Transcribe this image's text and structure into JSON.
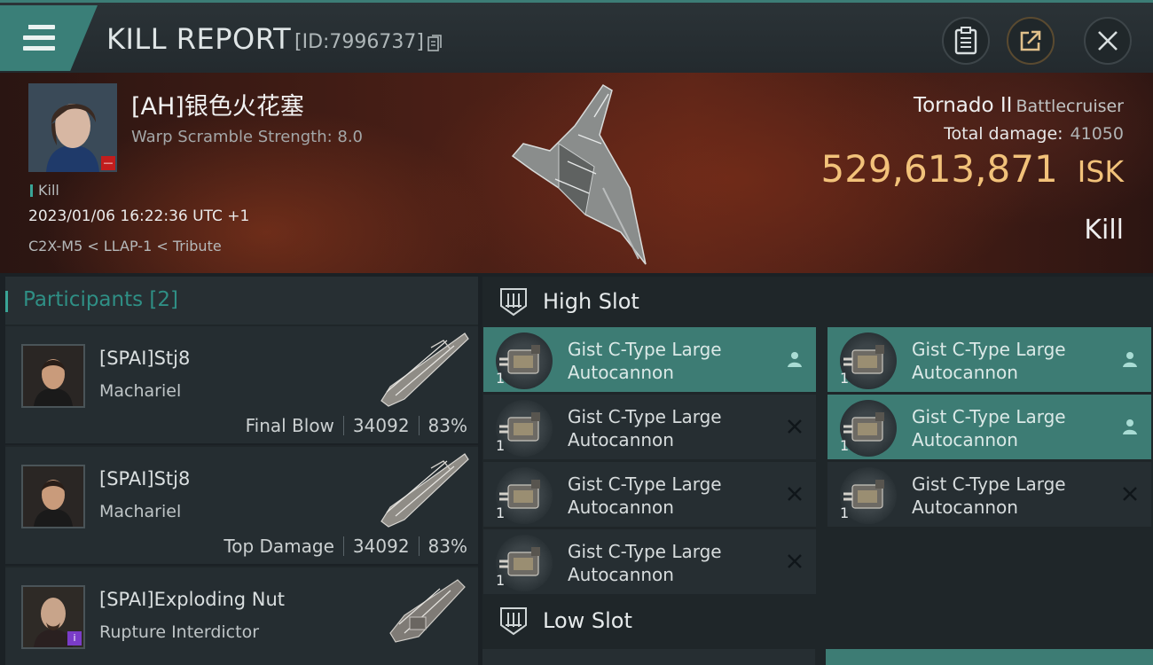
{
  "header": {
    "title": "KILL REPORT",
    "report_id": "[ID:7996737]",
    "menu_icon": "hamburger-icon",
    "buttons": [
      {
        "name": "clipboard-icon"
      },
      {
        "name": "share-icon"
      },
      {
        "name": "close-icon"
      }
    ]
  },
  "victim": {
    "name": "[AH]银色火花塞",
    "scramble": "Warp Scramble Strength: 8.0",
    "tag": "Kill",
    "date": "2023/01/06 16:22:36 UTC +1",
    "location": "C2X-M5 < LLAP-1 < Tribute",
    "ship_name": "Tornado II",
    "ship_class": "Battlecruiser",
    "total_damage_label": "Total damage:",
    "total_damage": "41050",
    "isk_value": "529,613,871",
    "isk_unit": "ISK",
    "result": "Kill"
  },
  "participants": {
    "header": "Participants [2]",
    "rows": [
      {
        "name": "[SPAI]Stj8",
        "ship": "Machariel",
        "label": "Final Blow",
        "damage": "34092",
        "percent": "83%"
      },
      {
        "name": "[SPAI]Stj8",
        "ship": "Machariel",
        "label": "Top Damage",
        "damage": "34092",
        "percent": "83%"
      },
      {
        "name": "[SPAI]Exploding Nut",
        "ship": "Rupture Interdictor",
        "badge": "i"
      }
    ]
  },
  "slots": {
    "high_title": "High Slot",
    "low_title": "Low Slot",
    "modules": [
      {
        "line1": "Gist C-Type Large",
        "line2": "Autocannon",
        "qty": "1",
        "status": "dropped"
      },
      {
        "line1": "Gist C-Type Large",
        "line2": "Autocannon",
        "qty": "1",
        "status": "dropped"
      },
      {
        "line1": "Gist C-Type Large",
        "line2": "Autocannon",
        "qty": "1",
        "status": "destroyed"
      },
      {
        "line1": "Gist C-Type Large",
        "line2": "Autocannon",
        "qty": "1",
        "status": "dropped"
      },
      {
        "line1": "Gist C-Type Large",
        "line2": "Autocannon",
        "qty": "1",
        "status": "destroyed"
      },
      {
        "line1": "Gist C-Type Large",
        "line2": "Autocannon",
        "qty": "1",
        "status": "destroyed"
      },
      {
        "line1": "Gist C-Type Large",
        "line2": "Autocannon",
        "qty": "1",
        "status": "destroyed"
      }
    ]
  },
  "colors": {
    "accent": "#3aa597",
    "dropped_bg": "#3d7c74",
    "isk": "#f2c27a"
  }
}
